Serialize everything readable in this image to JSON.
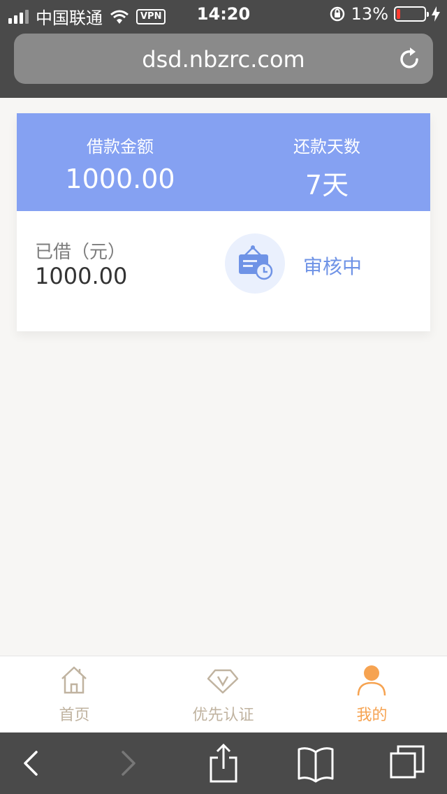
{
  "status_bar": {
    "carrier": "中国联通",
    "vpn": "VPN",
    "time": "14:20",
    "battery": "13%",
    "battery_level": 0.13,
    "battery_color": "#ff3b30"
  },
  "browser": {
    "url": "dsd.nbzrc.com"
  },
  "loan_card": {
    "amount_label": "借款金额",
    "amount_value": "1000.00",
    "days_label": "还款天数",
    "days_value": "7天",
    "borrowed_label": "已借（元）",
    "borrowed_value": "1000.00",
    "status_text": "审核中",
    "status_icon": "review-board-icon",
    "header_color": "#85a1f2",
    "status_color": "#6f93e6"
  },
  "tab_bar": {
    "tabs": [
      {
        "label": "首页",
        "icon": "home-icon",
        "active": false
      },
      {
        "label": "优先认证",
        "icon": "vip-diamond-icon",
        "active": false
      },
      {
        "label": "我的",
        "icon": "user-icon",
        "active": true
      }
    ],
    "active_color": "#f6a351",
    "inactive_color": "#c0b3a0"
  },
  "browser_toolbar": {
    "icons": [
      "back-icon",
      "forward-icon",
      "share-icon",
      "bookmarks-icon",
      "tabs-icon"
    ]
  }
}
